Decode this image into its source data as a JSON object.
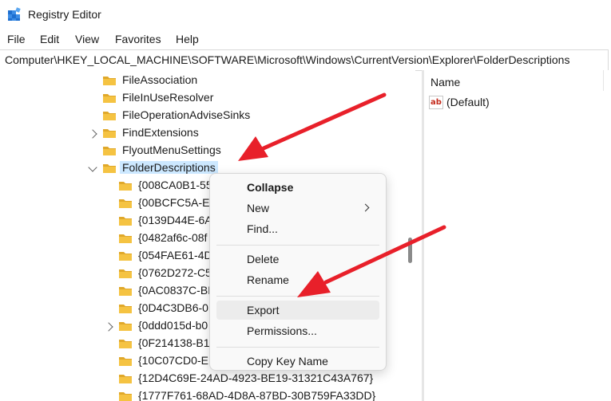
{
  "window": {
    "title": "Registry Editor"
  },
  "menubar": {
    "items": [
      "File",
      "Edit",
      "View",
      "Favorites",
      "Help"
    ]
  },
  "address": {
    "path": "Computer\\HKEY_LOCAL_MACHINE\\SOFTWARE\\Microsoft\\Windows\\CurrentVersion\\Explorer\\FolderDescriptions"
  },
  "tree": {
    "items": [
      {
        "label": "FileAssociation",
        "level": 0,
        "chevron": "none"
      },
      {
        "label": "FileInUseResolver",
        "level": 0,
        "chevron": "none"
      },
      {
        "label": "FileOperationAdviseSinks",
        "level": 0,
        "chevron": "none"
      },
      {
        "label": "FindExtensions",
        "level": 0,
        "chevron": "right"
      },
      {
        "label": "FlyoutMenuSettings",
        "level": 0,
        "chevron": "none"
      },
      {
        "label": "FolderDescriptions",
        "level": 0,
        "chevron": "down",
        "selected": true
      },
      {
        "label": "{008CA0B1-55",
        "level": 1,
        "chevron": "none"
      },
      {
        "label": "{00BCFC5A-EI",
        "level": 1,
        "chevron": "none"
      },
      {
        "label": "{0139D44E-6A",
        "level": 1,
        "chevron": "none"
      },
      {
        "label": "{0482af6c-08f",
        "level": 1,
        "chevron": "none"
      },
      {
        "label": "{054FAE61-4D",
        "level": 1,
        "chevron": "none"
      },
      {
        "label": "{0762D272-C5",
        "level": 1,
        "chevron": "none"
      },
      {
        "label": "{0AC0837C-BI",
        "level": 1,
        "chevron": "none"
      },
      {
        "label": "{0D4C3DB6-0",
        "level": 1,
        "chevron": "none"
      },
      {
        "label": "{0ddd015d-b0",
        "level": 1,
        "chevron": "right"
      },
      {
        "label": "{0F214138-B1",
        "level": 1,
        "chevron": "none"
      },
      {
        "label": "{10C07CD0-EI",
        "level": 1,
        "chevron": "none"
      },
      {
        "label": "{12D4C69E-24AD-4923-BE19-31321C43A767}",
        "level": 1,
        "chevron": "none"
      },
      {
        "label": "{1777F761-68AD-4D8A-87BD-30B759FA33DD}",
        "level": 1,
        "chevron": "none"
      }
    ]
  },
  "values_pane": {
    "column_name": "Name",
    "rows": [
      {
        "name": "(Default)",
        "icon": "ab-string-icon"
      }
    ]
  },
  "context_menu": {
    "items": [
      {
        "label": "Collapse",
        "bold": true
      },
      {
        "label": "New",
        "submenu": true
      },
      {
        "label": "Find..."
      },
      {
        "separator": true
      },
      {
        "label": "Delete"
      },
      {
        "label": "Rename"
      },
      {
        "separator": true
      },
      {
        "label": "Export",
        "hover": true
      },
      {
        "label": "Permissions..."
      },
      {
        "separator": true
      },
      {
        "label": "Copy Key Name"
      }
    ]
  },
  "colors": {
    "folder": "#f5c342",
    "folder_dark": "#e0a82a",
    "selection": "#cce8ff",
    "arrow": "#e8202a"
  }
}
